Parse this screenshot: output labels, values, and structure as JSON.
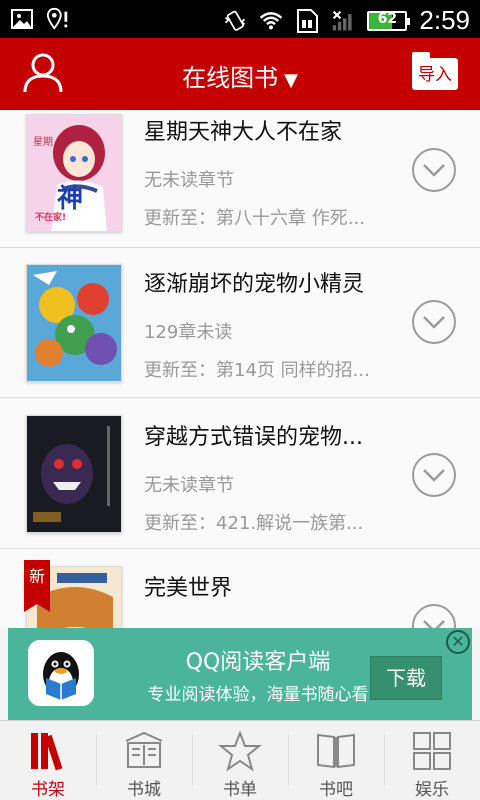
{
  "status_bar": {
    "battery": "62",
    "battery_level": 0.62,
    "time": "2:59",
    "icons": [
      "gallery-icon",
      "location-alert-icon",
      "vibrate-icon",
      "wifi-icon",
      "sim-icon",
      "signal-icon",
      "battery-icon"
    ]
  },
  "header": {
    "title": "在线图书",
    "caret": "▼",
    "import_label": "导入",
    "user_icon": "user-icon",
    "color": "#c40000"
  },
  "books": [
    {
      "title": "星期天神大人不在家",
      "status": "无未读章节",
      "update": "更新至：第八十六章 作死...",
      "cover_text": "神",
      "cover_caption": "不在家!"
    },
    {
      "title": "逐渐崩坏的宠物小精灵",
      "status": "129章未读",
      "update": "更新至：第14页 同样的招..."
    },
    {
      "title": "穿越方式错误的宠物...",
      "status": "无未读章节",
      "update": "更新至：421.解说一族第..."
    },
    {
      "title": "完美世界",
      "new_badge": "新"
    }
  ],
  "ad": {
    "title": "QQ阅读客户端",
    "subtitle": "专业阅读体验，海量书随心看",
    "download_label": "下载",
    "close_label": "✕",
    "color": "#4ab59b"
  },
  "nav": {
    "items": [
      {
        "label": "书架",
        "icon": "bookshelf-icon",
        "active": true
      },
      {
        "label": "书城",
        "icon": "bookstore-icon",
        "active": false
      },
      {
        "label": "书单",
        "icon": "star-icon",
        "active": false
      },
      {
        "label": "书吧",
        "icon": "open-book-icon",
        "active": false
      },
      {
        "label": "娱乐",
        "icon": "grid-icon",
        "active": false
      }
    ]
  }
}
